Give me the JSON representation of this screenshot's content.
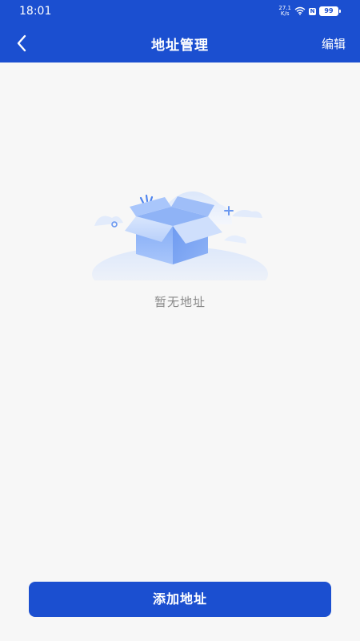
{
  "status_bar": {
    "time": "18:01",
    "net_speed_value": "27.1",
    "net_speed_unit": "K/s",
    "nfc_label": "N",
    "battery": "99"
  },
  "nav": {
    "title": "地址管理",
    "edit_label": "编辑",
    "back_icon": "chevron-left-icon"
  },
  "empty": {
    "message": "暂无地址",
    "illustration": "empty-box-icon"
  },
  "footer": {
    "add_label": "添加地址"
  },
  "colors": {
    "primary": "#1b4fd0",
    "background": "#f7f7f7",
    "muted_text": "#888888"
  }
}
